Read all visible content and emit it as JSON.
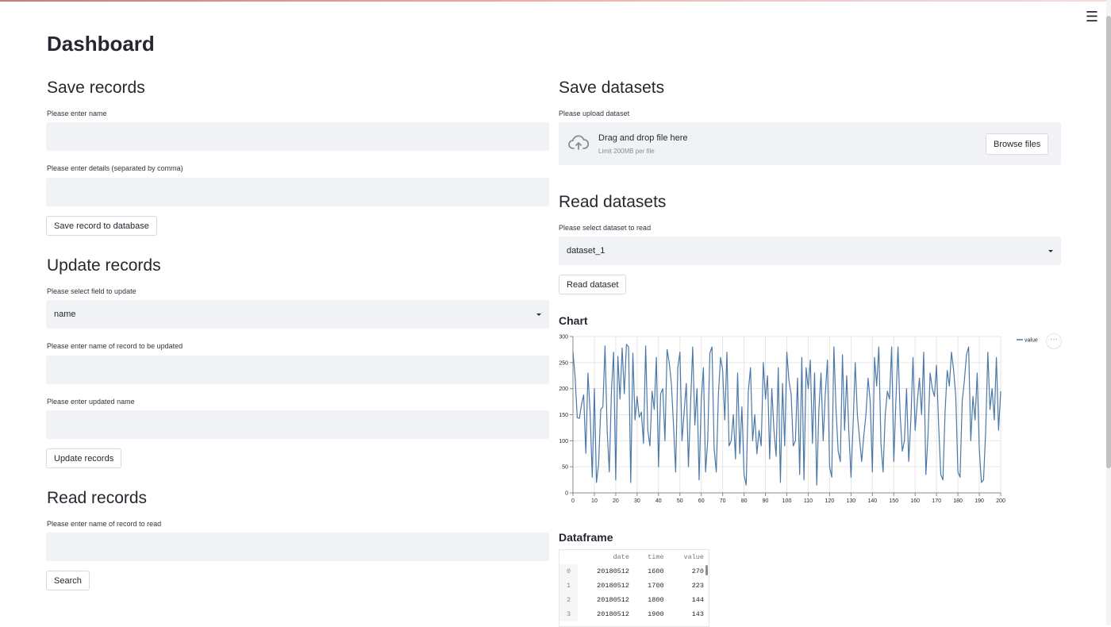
{
  "page": {
    "title": "Dashboard",
    "menu_icon": "hamburger-icon"
  },
  "save_records": {
    "heading": "Save records",
    "name_label": "Please enter name",
    "name_value": "",
    "details_label": "Please enter details (separated by comma)",
    "details_value": "",
    "button": "Save record to database"
  },
  "update_records": {
    "heading": "Update records",
    "field_label": "Please select field to update",
    "field_value": "name",
    "record_label": "Please enter name of record to be updated",
    "record_value": "",
    "new_label": "Please enter updated name",
    "new_value": "",
    "button": "Update records"
  },
  "read_records": {
    "heading": "Read records",
    "label": "Please enter name of record to read",
    "value": "",
    "button": "Search"
  },
  "save_datasets": {
    "heading": "Save datasets",
    "label": "Please upload dataset",
    "drop_text": "Drag and drop file here",
    "limit_text": "Limit 200MB per file",
    "button": "Browse files",
    "icon": "cloud-upload-icon"
  },
  "read_datasets": {
    "heading": "Read datasets",
    "label": "Please select dataset to read",
    "selected": "dataset_1",
    "button": "Read dataset"
  },
  "chart": {
    "heading": "Chart",
    "menu_icon": "more-options-icon"
  },
  "chart_data": {
    "type": "line",
    "series": [
      {
        "name": "value",
        "color": "#4c78a8"
      }
    ],
    "x_ticks": [
      "0",
      "10",
      "20",
      "30",
      "40",
      "50",
      "60",
      "70",
      "80",
      "90",
      "100",
      "110",
      "120",
      "130",
      "140",
      "150",
      "160",
      "170",
      "180",
      "190",
      "200"
    ],
    "y_ticks": [
      "0",
      "50",
      "100",
      "150",
      "200",
      "250",
      "300"
    ],
    "xlim": [
      0,
      200
    ],
    "ylim": [
      0,
      300
    ],
    "grid": true,
    "legend": "top-right",
    "x": [
      0,
      1,
      2,
      3,
      4,
      5,
      6,
      7,
      8,
      9,
      10,
      11,
      12,
      13,
      14,
      15,
      16,
      17,
      18,
      19,
      20,
      21,
      22,
      23,
      24,
      25,
      26,
      27,
      28,
      29,
      30,
      31,
      32,
      33,
      34,
      35,
      36,
      37,
      38,
      39,
      40,
      41,
      42,
      43,
      44,
      45,
      46,
      47,
      48,
      49,
      50,
      51,
      52,
      53,
      54,
      55,
      56,
      57,
      58,
      59,
      60,
      61,
      62,
      63,
      64,
      65,
      66,
      67,
      68,
      69,
      70,
      71,
      72,
      73,
      74,
      75,
      76,
      77,
      78,
      79,
      80,
      81,
      82,
      83,
      84,
      85,
      86,
      87,
      88,
      89,
      90,
      91,
      92,
      93,
      94,
      95,
      96,
      97,
      98,
      99,
      100,
      101,
      102,
      103,
      104,
      105,
      106,
      107,
      108,
      109,
      110,
      111,
      112,
      113,
      114,
      115,
      116,
      117,
      118,
      119,
      120,
      121,
      122,
      123,
      124,
      125,
      126,
      127,
      128,
      129,
      130,
      131,
      132,
      133,
      134,
      135,
      136,
      137,
      138,
      139,
      140,
      141,
      142,
      143,
      144,
      145,
      146,
      147,
      148,
      149,
      150,
      151,
      152,
      153,
      154,
      155,
      156,
      157,
      158,
      159,
      160,
      161,
      162,
      163,
      164,
      165,
      166,
      167,
      168,
      169,
      170,
      171,
      172,
      173,
      174,
      175,
      176,
      177,
      178,
      179,
      180,
      181,
      182,
      183,
      184,
      185,
      186,
      187,
      188,
      189,
      190,
      191,
      192,
      193,
      194,
      195,
      196,
      197,
      198,
      199,
      200
    ],
    "values": [
      270,
      223,
      144,
      143,
      170,
      188,
      76,
      230,
      155,
      30,
      200,
      20,
      55,
      160,
      165,
      282,
      120,
      40,
      195,
      270,
      25,
      262,
      180,
      278,
      190,
      285,
      280,
      20,
      268,
      140,
      185,
      145,
      155,
      95,
      282,
      120,
      90,
      195,
      160,
      260,
      50,
      190,
      200,
      100,
      275,
      250,
      210,
      130,
      40,
      240,
      270,
      100,
      155,
      210,
      50,
      170,
      280,
      130,
      200,
      25,
      178,
      240,
      40,
      100,
      268,
      280,
      85,
      40,
      190,
      260,
      235,
      140,
      270,
      90,
      100,
      150,
      65,
      230,
      75,
      165,
      35,
      15,
      195,
      240,
      100,
      150,
      75,
      120,
      90,
      250,
      180,
      225,
      65,
      200,
      120,
      70,
      240,
      20,
      210,
      90,
      270,
      215,
      190,
      90,
      100,
      220,
      35,
      260,
      25,
      240,
      200,
      255,
      95,
      230,
      15,
      160,
      230,
      100,
      190,
      255,
      50,
      30,
      280,
      160,
      80,
      60,
      265,
      120,
      225,
      115,
      30,
      130,
      250,
      150,
      105,
      60,
      110,
      150,
      220,
      175,
      40,
      260,
      205,
      280,
      95,
      40,
      150,
      195,
      180,
      280,
      60,
      175,
      280,
      150,
      80,
      100,
      200,
      60,
      140,
      260,
      120,
      175,
      220,
      150,
      270,
      35,
      110,
      230,
      200,
      185,
      245,
      130,
      35,
      25,
      155,
      235,
      205,
      270,
      235,
      185,
      40,
      30,
      175,
      215,
      265,
      280,
      100,
      185,
      140,
      230,
      85,
      20,
      25,
      120,
      270,
      160,
      200,
      140,
      260,
      120,
      195
    ]
  },
  "dataframe": {
    "heading": "Dataframe",
    "columns": [
      "",
      "date",
      "time",
      "value"
    ],
    "rows": [
      [
        "0",
        "20180512",
        "1600",
        "270"
      ],
      [
        "1",
        "20180512",
        "1700",
        "223"
      ],
      [
        "2",
        "20180512",
        "1800",
        "144"
      ],
      [
        "3",
        "20180512",
        "1900",
        "143"
      ]
    ]
  }
}
